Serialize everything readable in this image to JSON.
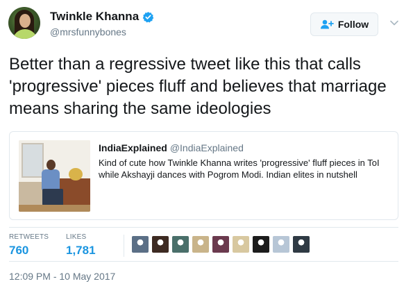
{
  "author": {
    "display_name": "Twinkle Khanna",
    "handle": "@mrsfunnybones",
    "verified": true,
    "avatar_icon": "profile-photo"
  },
  "actions": {
    "follow_label": "Follow",
    "follow_icon": "add-user-icon",
    "more_icon": "chevron-down-icon"
  },
  "tweet": {
    "text": "Better than a regressive tweet like this that calls 'progressive' pieces fluff and believes that marriage means sharing the same ideologies"
  },
  "quoted": {
    "name": "IndiaExplained",
    "handle": "@IndiaExplained",
    "text": "Kind of cute how Twinkle Khanna writes  'progressive' fluff pieces in ToI while Akshayji dances with Pogrom Modi. Indian elites in nutshell"
  },
  "stats": {
    "retweets_label": "RETWEETS",
    "retweets": "760",
    "likes_label": "LIKES",
    "likes": "1,781"
  },
  "likers": [
    {
      "color": "#5b6f86"
    },
    {
      "color": "#3d2a22"
    },
    {
      "color": "#4a6f6a"
    },
    {
      "color": "#c9b48a"
    },
    {
      "color": "#6b3a4e"
    },
    {
      "color": "#d8c8a0"
    },
    {
      "color": "#1c1c1c"
    },
    {
      "color": "#b7c6d6"
    },
    {
      "color": "#2f3a44"
    }
  ],
  "timestamp": "12:09 PM - 10 May 2017",
  "colors": {
    "accent": "#1b95e0",
    "verified": "#1da1f2",
    "muted": "#657786"
  }
}
